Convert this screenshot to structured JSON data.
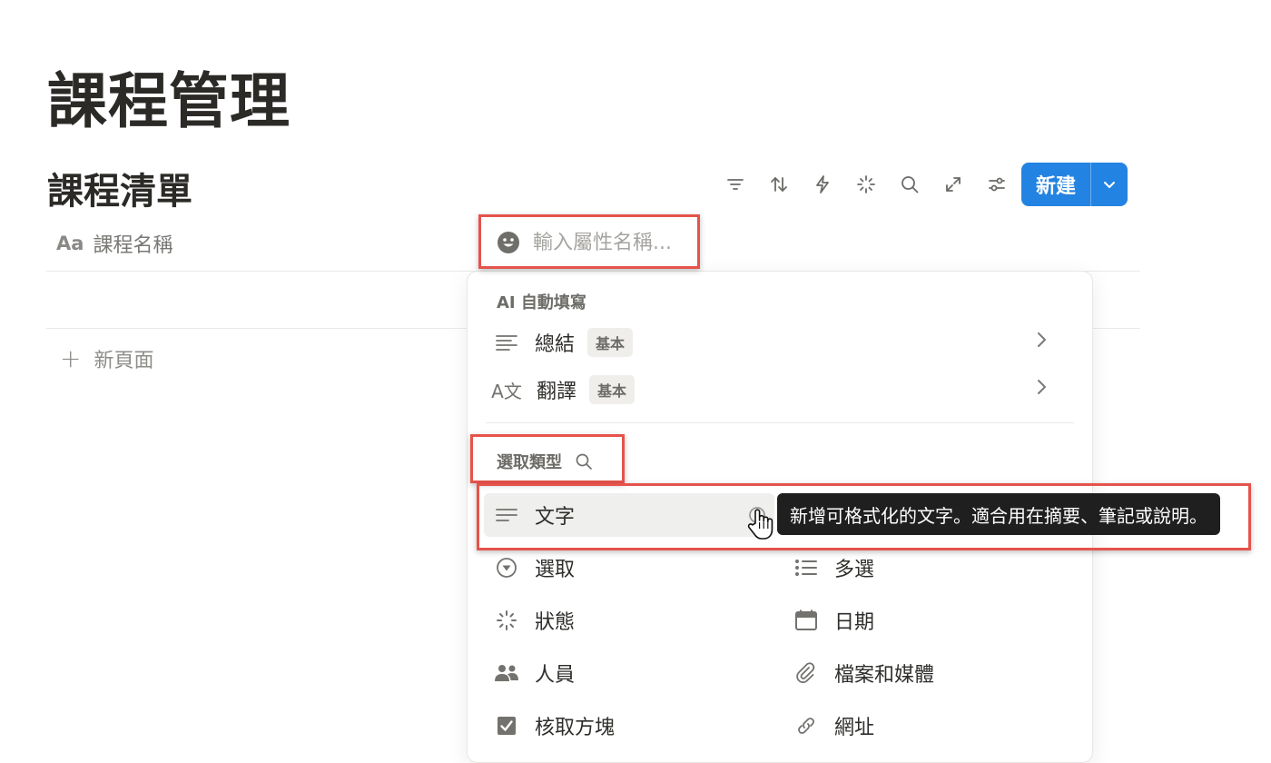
{
  "page": {
    "title": "課程管理"
  },
  "database": {
    "title": "課程清單",
    "toolbar": {
      "icons": [
        "filter-icon",
        "sort-icon",
        "automation-icon",
        "ai-sparkle-icon",
        "search-icon",
        "expand-icon",
        "settings-icon"
      ],
      "new_button_label": "新建"
    },
    "column": {
      "prefix": "Aa",
      "name": "課程名稱"
    },
    "new_page_label": "新頁面"
  },
  "property_input": {
    "placeholder": "輸入屬性名稱..."
  },
  "menu": {
    "ai_section_label": "AI 自動填寫",
    "ai_items": [
      {
        "label": "總結",
        "badge": "基本",
        "icon": "summary-lines-icon"
      },
      {
        "label": "翻譯",
        "badge": "基本",
        "icon": "translate-icon",
        "icon_text": "A文"
      }
    ],
    "type_section_label": "選取類型",
    "types": [
      {
        "label": "文字",
        "icon": "text-lines-icon"
      },
      {
        "label": "選取",
        "icon": "select-icon"
      },
      {
        "label": "多選",
        "icon": "multi-select-icon"
      },
      {
        "label": "狀態",
        "icon": "status-icon"
      },
      {
        "label": "日期",
        "icon": "calendar-icon"
      },
      {
        "label": "人員",
        "icon": "people-icon"
      },
      {
        "label": "檔案和媒體",
        "icon": "paperclip-icon"
      },
      {
        "label": "核取方塊",
        "icon": "checkbox-icon"
      },
      {
        "label": "網址",
        "icon": "link-icon"
      }
    ],
    "tooltip": "新增可格式化的文字。適合用在摘要、筆記或說明。"
  },
  "colors": {
    "accent": "#2383e2",
    "highlight": "#e5534b",
    "tooltip_bg": "#1f1f1f"
  }
}
